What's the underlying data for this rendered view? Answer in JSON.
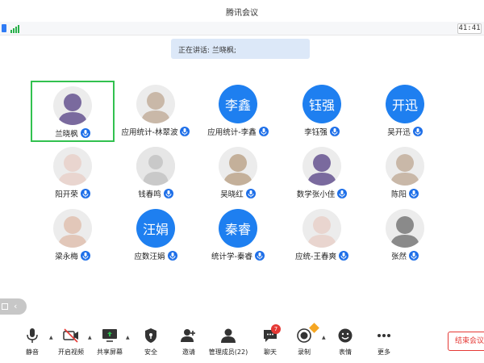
{
  "app": {
    "title": "腾讯会议"
  },
  "status": {
    "time": "41:41"
  },
  "speaker": {
    "text": "正在讲话: 兰晓枫;"
  },
  "participants": [
    {
      "name": "兰晓枫",
      "avatar_type": "photo",
      "active": true
    },
    {
      "name": "应用统计-林翠波",
      "avatar_type": "photo"
    },
    {
      "name": "应用统计-李鑫",
      "avatar_type": "text",
      "avatar_text": "李鑫"
    },
    {
      "name": "李钰强",
      "avatar_type": "text",
      "avatar_text": "钰强"
    },
    {
      "name": "吴开迅",
      "avatar_type": "text",
      "avatar_text": "开迅"
    },
    {
      "name": "阳开荣",
      "avatar_type": "photo"
    },
    {
      "name": "钱春鸣",
      "avatar_type": "default"
    },
    {
      "name": "吴晓红",
      "avatar_type": "photo"
    },
    {
      "name": "数学张小佳",
      "avatar_type": "photo"
    },
    {
      "name": "陈阳",
      "avatar_type": "photo"
    },
    {
      "name": "梁永梅",
      "avatar_type": "photo"
    },
    {
      "name": "应数汪娟",
      "avatar_type": "text",
      "avatar_text": "汪娟"
    },
    {
      "name": "统计学-秦睿",
      "avatar_type": "text",
      "avatar_text": "秦睿"
    },
    {
      "name": "应统-王春爽",
      "avatar_type": "photo"
    },
    {
      "name": "张然",
      "avatar_type": "photo"
    }
  ],
  "toolbar": {
    "mute": "静音",
    "video": "开启视频",
    "share": "共享屏幕",
    "security": "安全",
    "invite": "邀请",
    "members": "管理成员(22)",
    "chat": "聊天",
    "chat_badge": "7",
    "record": "录制",
    "reactions": "表情",
    "more": "更多",
    "end": "结束会议"
  },
  "colors": {
    "accent": "#1e7ff0",
    "active_border": "#32c14f",
    "end": "#e53935"
  }
}
